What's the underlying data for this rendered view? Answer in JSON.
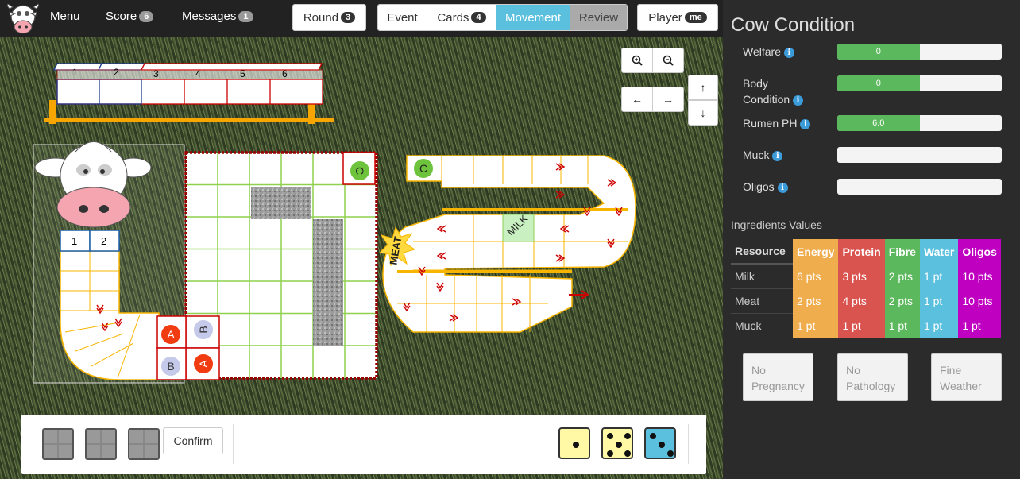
{
  "nav": {
    "menu": "Menu",
    "score_label": "Score",
    "score_count": "6",
    "messages_label": "Messages",
    "messages_count": "1"
  },
  "toolbar": {
    "round_label": "Round",
    "round_value": "3",
    "phases": [
      {
        "label": "Event",
        "count": null,
        "state": "normal"
      },
      {
        "label": "Cards",
        "count": "4",
        "state": "normal"
      },
      {
        "label": "Movement",
        "count": null,
        "state": "active"
      },
      {
        "label": "Review",
        "count": null,
        "state": "disabled"
      }
    ],
    "player_label": "Player",
    "player_badge": "me"
  },
  "board": {
    "feed_bunk_slots": [
      "1",
      "2",
      "3",
      "4",
      "5",
      "6"
    ],
    "mouth_slots": [
      "1",
      "2"
    ],
    "markers": {
      "a": "A",
      "b": "B",
      "c": "C"
    },
    "stomach_labels": {
      "meat": "MEAT",
      "milk": "MILK"
    },
    "controls": {
      "zoom_in": "zoom-in",
      "zoom_out": "zoom-out",
      "pan_left": "←",
      "pan_right": "→",
      "pan_up": "↑",
      "pan_down": "↓"
    }
  },
  "action_bar": {
    "confirm_label": "Confirm",
    "dice": [
      {
        "color": "#fff9a6",
        "value": 1
      },
      {
        "color": "#fff9a6",
        "value": 5
      },
      {
        "color": "#5bc0de",
        "value": 3
      }
    ]
  },
  "cow_condition": {
    "title": "Cow Condition",
    "metrics": [
      {
        "label": "Welfare",
        "value": "0",
        "fill": 0.5
      },
      {
        "label": "Body Condition",
        "value": "0",
        "fill": 0.5
      },
      {
        "label": "Rumen PH",
        "value": "6.0",
        "fill": 0.5
      },
      {
        "label": "Muck",
        "value": "",
        "fill": 0
      },
      {
        "label": "Oligos",
        "value": "",
        "fill": 0
      }
    ]
  },
  "ingredients": {
    "title": "Ingredients Values",
    "columns": [
      {
        "label": "Resource",
        "color": null
      },
      {
        "label": "Energy",
        "color": "#f0ad4e"
      },
      {
        "label": "Protein",
        "color": "#d9534f"
      },
      {
        "label": "Fibre",
        "color": "#5cb85c"
      },
      {
        "label": "Water",
        "color": "#5bc0de"
      },
      {
        "label": "Oligos",
        "color": "#c000c0"
      }
    ],
    "rows": [
      {
        "name": "Milk",
        "values": [
          "6 pts",
          "3 pts",
          "2 pts",
          "1 pt",
          "10 pts"
        ]
      },
      {
        "name": "Meat",
        "values": [
          "2 pts",
          "4 pts",
          "2 pts",
          "1 pt",
          "10 pts"
        ]
      },
      {
        "name": "Muck",
        "values": [
          "1 pt",
          "1 pt",
          "1 pt",
          "1 pt",
          "1 pt"
        ]
      }
    ]
  },
  "status_cards": [
    "No Pregnancy",
    "No Pathology",
    "Fine Weather"
  ]
}
